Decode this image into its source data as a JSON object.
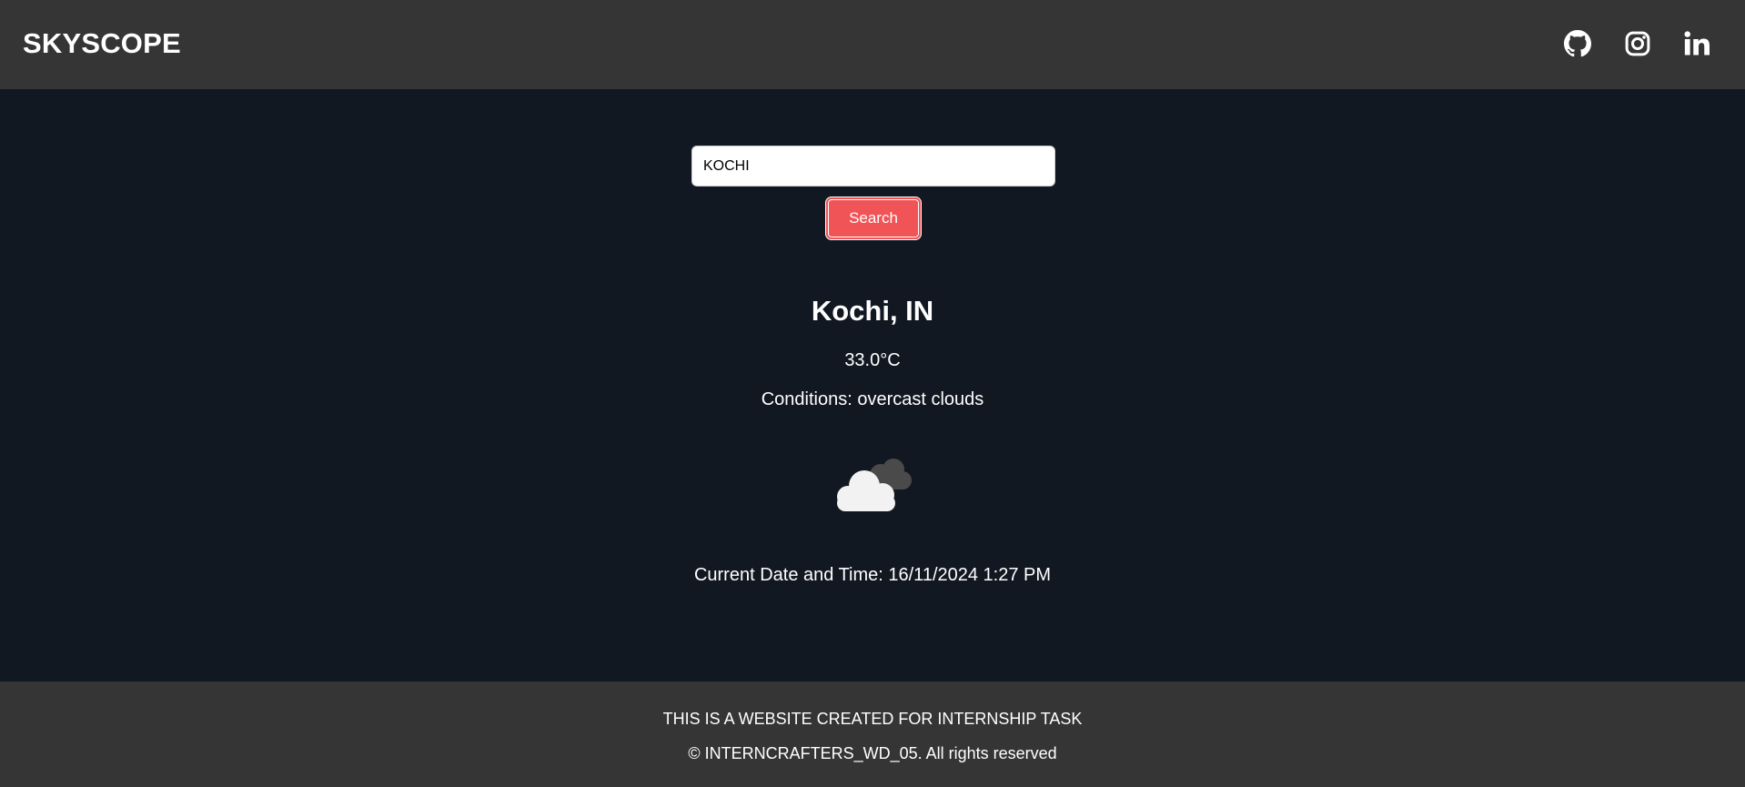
{
  "header": {
    "logo": "SKYSCOPE",
    "social": [
      {
        "icon": "github-icon"
      },
      {
        "icon": "instagram-icon"
      },
      {
        "icon": "linkedin-icon"
      }
    ]
  },
  "search": {
    "value": "KOCHI",
    "button_label": "Search"
  },
  "weather": {
    "city": "Kochi, IN",
    "temperature": "33.0°C",
    "conditions": "Conditions: overcast clouds",
    "icon": "overcast-clouds-icon",
    "datetime": "Current Date and Time: 16/11/2024 1:27 PM"
  },
  "footer": {
    "line1": "THIS IS A WEBSITE CREATED FOR INTERNSHIP TASK",
    "line2": "© INTERNCRAFTERS_WD_05. All rights reserved"
  },
  "colors": {
    "header_bg": "#353535",
    "main_bg": "#111821",
    "accent": "#f05456",
    "text": "#ffffff"
  }
}
